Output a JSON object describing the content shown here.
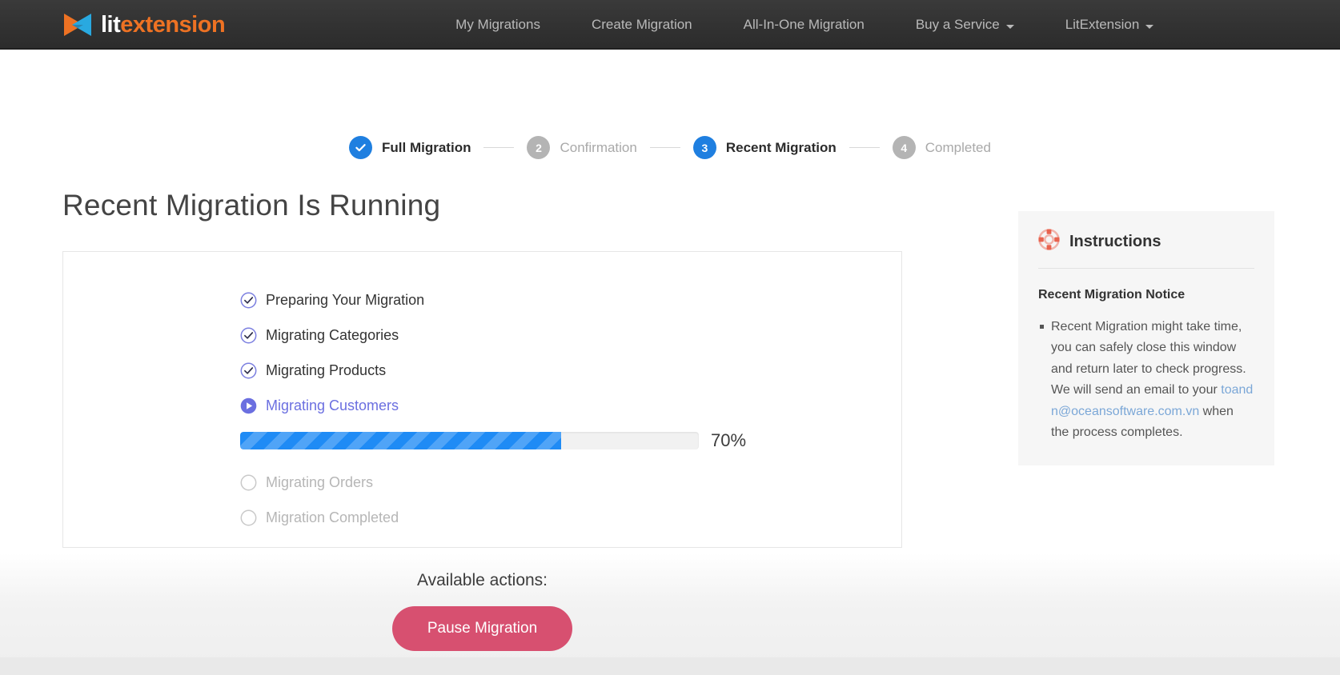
{
  "navbar": {
    "logo": {
      "icon": "litextension-logo-icon",
      "text_part1": "lit",
      "text_part2": "extension",
      "color_orange": "#ee7223",
      "color_blue": "#29a9e0"
    },
    "links": [
      {
        "label": "My Migrations",
        "has_caret": false
      },
      {
        "label": "Create Migration",
        "has_caret": false
      },
      {
        "label": "All-In-One Migration",
        "has_caret": false
      },
      {
        "label": "Buy a Service",
        "has_caret": true
      },
      {
        "label": "LitExtension",
        "has_caret": true
      }
    ]
  },
  "stepper": {
    "steps": [
      {
        "number": "1",
        "label": "Full Migration",
        "state": "done",
        "icon": "check-circle-icon"
      },
      {
        "number": "2",
        "label": "Confirmation",
        "state": "todo",
        "icon": ""
      },
      {
        "number": "3",
        "label": "Recent Migration",
        "state": "active",
        "icon": ""
      },
      {
        "number": "4",
        "label": "Completed",
        "state": "todo",
        "icon": ""
      }
    ],
    "active_color": "#1f7fe0",
    "inactive_color": "#b4b4b4"
  },
  "main": {
    "page_title": "Recent Migration Is Running",
    "tasks": [
      {
        "label": "Preparing Your Migration",
        "state": "done",
        "icon": "check-circle-outline-icon"
      },
      {
        "label": "Migrating Categories",
        "state": "done",
        "icon": "check-circle-outline-icon"
      },
      {
        "label": "Migrating Products",
        "state": "done",
        "icon": "check-circle-outline-icon"
      },
      {
        "label": "Migrating Customers",
        "state": "active",
        "icon": "play-circle-icon"
      },
      {
        "label": "Migrating Orders",
        "state": "pending",
        "icon": "empty-circle-icon"
      },
      {
        "label": "Migration Completed",
        "state": "pending",
        "icon": "empty-circle-icon"
      }
    ],
    "progress": {
      "percent": 70,
      "percent_label": "70%",
      "bar_color": "#1f8bf5",
      "track_color": "#f1f1f1"
    }
  },
  "actions": {
    "heading": "Available actions:",
    "pause_label": "Pause Migration",
    "pause_color": "#d75070"
  },
  "instructions": {
    "icon": "lifebuoy-icon",
    "icon_color": "#e8634f",
    "title": "Instructions",
    "subtitle": "Recent Migration Notice",
    "bullet_text_before": "Recent Migration might take time, you can safely close this window and return later to check progress. We will send an email to your ",
    "bullet_link": "toandn@oceansoftware.com.vn",
    "bullet_text_after": " when the process completes.",
    "link_color": "#7ba7d7"
  }
}
